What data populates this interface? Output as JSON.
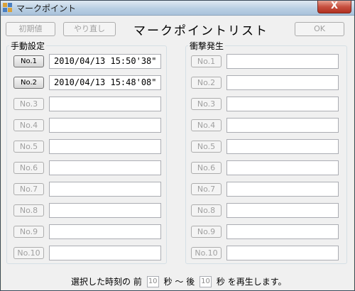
{
  "window": {
    "title": "マークポイント",
    "close_label": "X"
  },
  "toolbar": {
    "initial_label": "初期値",
    "redo_label": "やり直し",
    "ok_label": "OK",
    "title": "マークポイントリスト"
  },
  "manual": {
    "label": "手動設定",
    "rows": [
      {
        "label": "No.1",
        "value": "2010/04/13 15:50'38\""
      },
      {
        "label": "No.2",
        "value": "2010/04/13 15:48'08\""
      },
      {
        "label": "No.3",
        "value": ""
      },
      {
        "label": "No.4",
        "value": ""
      },
      {
        "label": "No.5",
        "value": ""
      },
      {
        "label": "No.6",
        "value": ""
      },
      {
        "label": "No.7",
        "value": ""
      },
      {
        "label": "No.8",
        "value": ""
      },
      {
        "label": "No.9",
        "value": ""
      },
      {
        "label": "No.10",
        "value": ""
      }
    ]
  },
  "impact": {
    "label": "衝撃発生",
    "rows": [
      {
        "label": "No.1",
        "value": ""
      },
      {
        "label": "No.2",
        "value": ""
      },
      {
        "label": "No.3",
        "value": ""
      },
      {
        "label": "No.4",
        "value": ""
      },
      {
        "label": "No.5",
        "value": ""
      },
      {
        "label": "No.6",
        "value": ""
      },
      {
        "label": "No.7",
        "value": ""
      },
      {
        "label": "No.8",
        "value": ""
      },
      {
        "label": "No.9",
        "value": ""
      },
      {
        "label": "No.10",
        "value": ""
      }
    ]
  },
  "footer": {
    "text1": "選択した時刻の",
    "before_label": "前",
    "before_value": "10",
    "sec1": "秒",
    "tilde": "～",
    "after_label": "後",
    "after_value": "10",
    "text2": "秒 を再生します。"
  }
}
